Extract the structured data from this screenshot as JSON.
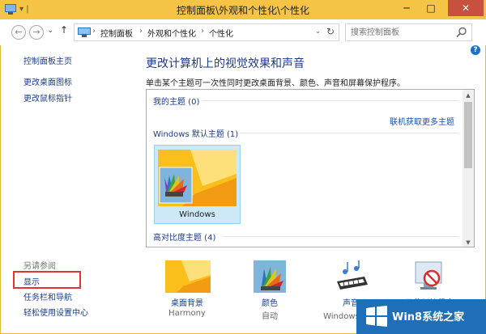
{
  "window": {
    "title": "控制面板\\外观和个性化\\个性化",
    "minimize": "─",
    "maximize": "□",
    "close": "✕"
  },
  "addressbar": {
    "back": "←",
    "forward": "→",
    "recent": "⌄",
    "up": "↑",
    "crumbs": [
      "控制面板",
      "外观和个性化",
      "个性化"
    ],
    "separator": "›",
    "dropdown": "⌄",
    "refresh": "↻"
  },
  "search": {
    "placeholder": "搜索控制面板"
  },
  "help": {
    "label": "?"
  },
  "sidebar": {
    "items": [
      {
        "label": "控制面板主页"
      },
      {
        "label": "更改桌面图标"
      },
      {
        "label": "更改鼠标指针"
      }
    ]
  },
  "seealso": {
    "heading": "另请参阅",
    "items": [
      {
        "label": "显示"
      },
      {
        "label": "任务栏和导航"
      },
      {
        "label": "轻松使用设置中心"
      }
    ]
  },
  "main": {
    "heading": "更改计算机上的视觉效果和声音",
    "description": "单击某个主题可一次性同时更改桌面背景、颜色、声音和屏幕保护程序。",
    "themes": {
      "my_themes": "我的主题 (0)",
      "get_more": "联机获取更多主题",
      "windows_default": "Windows 默认主题 (1)",
      "windows_theme_name": "Windows",
      "high_contrast": "高对比度主题 (4)"
    }
  },
  "bottom": {
    "items": [
      {
        "label": "桌面背景",
        "sub": "Harmony",
        "icon": "desktop-background-icon"
      },
      {
        "label": "颜色",
        "sub": "自动",
        "icon": "color-icon"
      },
      {
        "label": "声音",
        "sub": "Windows 默认",
        "icon": "sound-icon"
      },
      {
        "label": "屏幕保护程序",
        "sub": "",
        "icon": "screensaver-icon"
      }
    ]
  },
  "watermark": {
    "text": "Win8系统之家"
  },
  "colors": {
    "titlebar": "#f6c445",
    "link": "#1a3e8a",
    "heading": "#1e3a8a",
    "selection": "#cde8f7",
    "highlight_box": "#e03535"
  }
}
